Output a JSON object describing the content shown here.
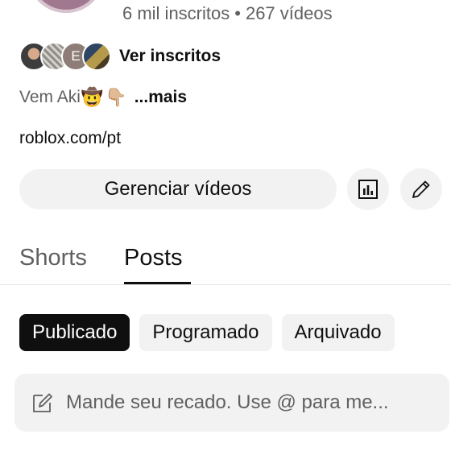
{
  "channel": {
    "subscribers": "6 mil inscritos",
    "separator": "•",
    "videos": "267 vídeos",
    "subscribers_link": "Ver inscritos",
    "mini_avatar_letter": "E",
    "description_text": "Vem Aki",
    "description_emojis": [
      "🤠",
      "👇🏼"
    ],
    "description_more": "...mais",
    "link": "roblox.com/pt"
  },
  "actions": {
    "manage_videos": "Gerenciar vídeos",
    "stats_icon": "analytics-icon",
    "edit_icon": "pencil-icon"
  },
  "tabs": [
    {
      "label": "Shorts",
      "selected": false
    },
    {
      "label": "Posts",
      "selected": true
    }
  ],
  "filters": [
    {
      "label": "Publicado",
      "selected": true
    },
    {
      "label": "Programado",
      "selected": false
    },
    {
      "label": "Arquivado",
      "selected": false
    }
  ],
  "composer": {
    "icon": "edit-icon",
    "placeholder": "Mande seu recado. Use @ para me..."
  },
  "colors": {
    "text_primary": "#0f0f0f",
    "text_secondary": "#606060",
    "chip_bg": "#f2f2f2",
    "chip_active_bg": "#0f0f0f"
  }
}
